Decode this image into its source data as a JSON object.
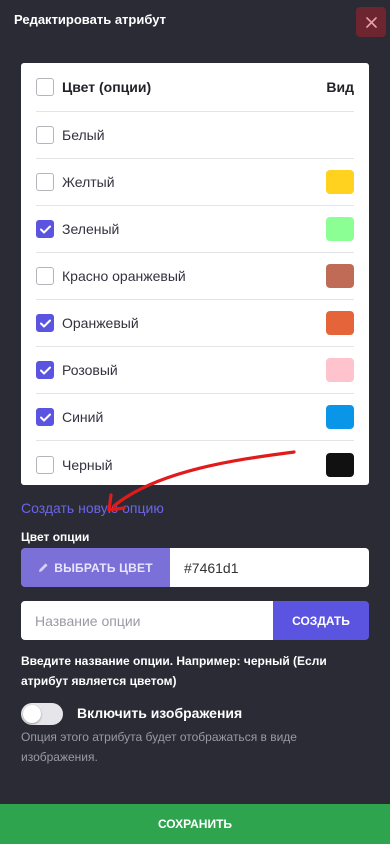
{
  "header": {
    "title": "Редактировать атрибут"
  },
  "table": {
    "header_label": "Цвет (опции)",
    "header_view": "Вид",
    "rows": [
      {
        "label": "Белый",
        "checked": false,
        "color": null
      },
      {
        "label": "Желтый",
        "checked": false,
        "color": "#ffd21f"
      },
      {
        "label": "Зеленый",
        "checked": true,
        "color": "#8bff94"
      },
      {
        "label": "Красно оранжевый",
        "checked": false,
        "color": "#c06b55"
      },
      {
        "label": "Оранжевый",
        "checked": true,
        "color": "#e5643a"
      },
      {
        "label": "Розовый",
        "checked": true,
        "color": "#ffc3cd"
      },
      {
        "label": "Синий",
        "checked": true,
        "color": "#0a96e8"
      },
      {
        "label": "Черный",
        "checked": false,
        "color": "#111111"
      }
    ]
  },
  "create_link": "Создать новую опцию",
  "color_option": {
    "label": "Цвет опции",
    "pick_button": "ВЫБРАТЬ ЦВЕТ",
    "value": "#7461d1"
  },
  "name_option": {
    "placeholder": "Название опции",
    "value": "",
    "create_button": "СОЗДАТЬ",
    "hint": "Введите название опции. Например: черный (Если атрибут является цветом)"
  },
  "images_toggle": {
    "label": "Включить изображения",
    "on": false,
    "description": "Опция этого атрибута будет отображаться в виде изображения."
  },
  "save_button": "СОХРАНИТЬ",
  "colors": {
    "accent": "#5b54e0",
    "close_bg": "#6d2530",
    "save_bg": "#2ea44f",
    "background": "#2b2b36"
  }
}
